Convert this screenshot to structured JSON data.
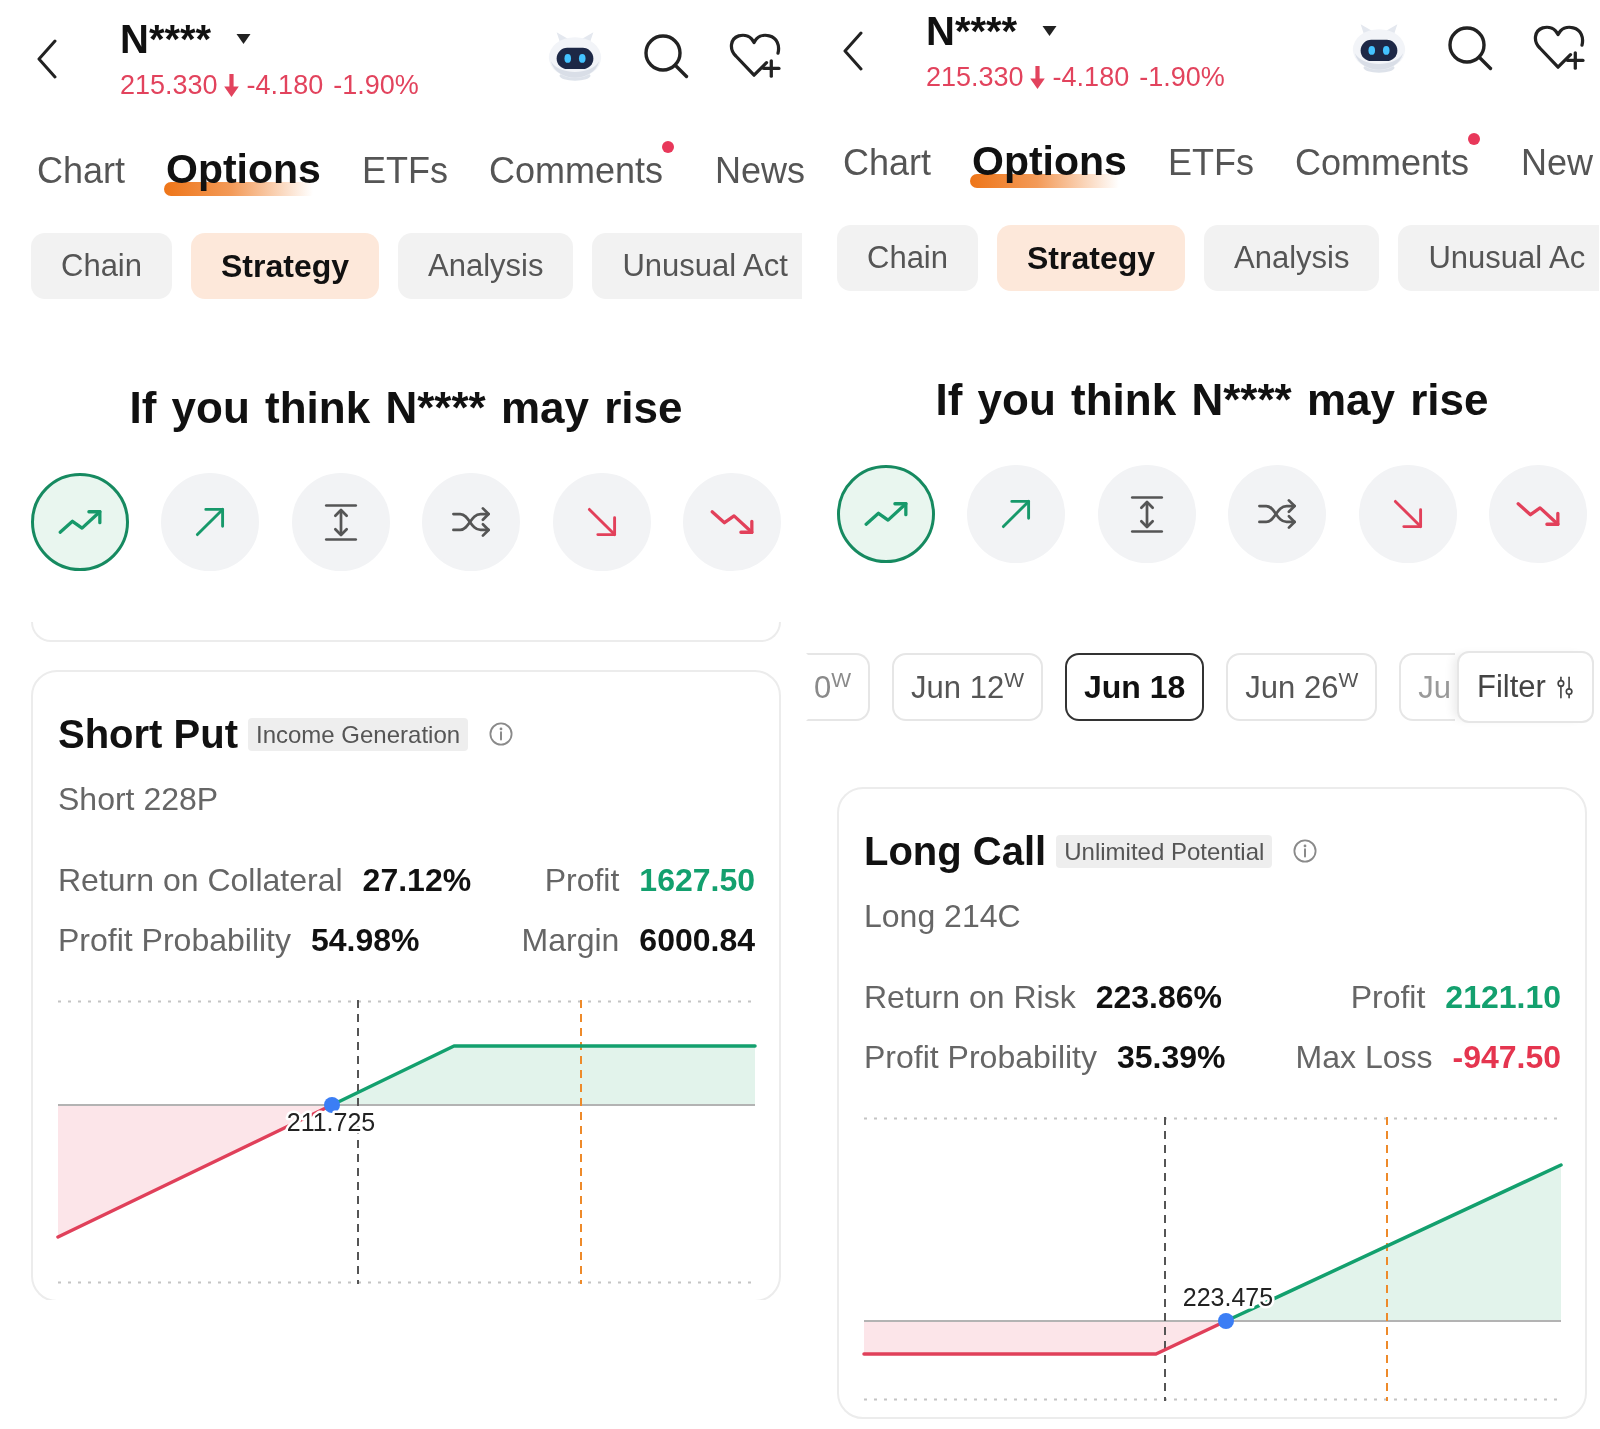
{
  "screens": [
    {
      "header": {
        "symbol": "N****",
        "price": "215.330",
        "change": "-4.180",
        "change_percent": "-1.90%"
      },
      "tabs": [
        {
          "label": "Chart",
          "selected": false,
          "dot": false
        },
        {
          "label": "Options",
          "selected": true,
          "dot": false
        },
        {
          "label": "ETFs",
          "selected": false,
          "dot": false
        },
        {
          "label": "Comments",
          "selected": false,
          "dot": true
        },
        {
          "label": "News",
          "selected": false,
          "dot": false
        }
      ],
      "subtabs": [
        {
          "label": "Chain",
          "selected": false
        },
        {
          "label": "Strategy",
          "selected": true
        },
        {
          "label": "Analysis",
          "selected": false
        },
        {
          "label": "Unusual Act",
          "selected": false
        }
      ],
      "heading": "If you think N**** may rise",
      "outlooks": [
        {
          "kind": "trend_up",
          "selected": true
        },
        {
          "kind": "arrow_up",
          "selected": false
        },
        {
          "kind": "range",
          "selected": false
        },
        {
          "kind": "shuffle",
          "selected": false
        },
        {
          "kind": "arrow_down",
          "selected": false
        },
        {
          "kind": "trend_down",
          "selected": false
        }
      ],
      "partial_card_above": true,
      "strategy": {
        "kind": "short_put",
        "name": "Short Put",
        "tag": "Income Generation",
        "legs": "Short 228P",
        "metrics": [
          {
            "label": "Return on Collateral",
            "value": "27.12%",
            "color": "#111111"
          },
          {
            "label": "Profit",
            "value": "1627.50",
            "color": "#13a06e"
          },
          {
            "label": "Profit Probability",
            "value": "54.98%",
            "color": "#111111"
          },
          {
            "label": "Margin",
            "value": "6000.84",
            "color": "#111111"
          }
        ],
        "breakeven": "211.725"
      }
    },
    {
      "header": {
        "symbol": "N****",
        "price": "215.330",
        "change": "-4.180",
        "change_percent": "-1.90%"
      },
      "tabs": [
        {
          "label": "Chart",
          "selected": false,
          "dot": false
        },
        {
          "label": "Options",
          "selected": true,
          "dot": false
        },
        {
          "label": "ETFs",
          "selected": false,
          "dot": false
        },
        {
          "label": "Comments",
          "selected": false,
          "dot": true
        },
        {
          "label": "New",
          "selected": false,
          "dot": false
        }
      ],
      "subtabs": [
        {
          "label": "Chain",
          "selected": false
        },
        {
          "label": "Strategy",
          "selected": true
        },
        {
          "label": "Analysis",
          "selected": false
        },
        {
          "label": "Unusual Ac",
          "selected": false
        }
      ],
      "heading": "If you think N**** may rise",
      "outlooks": [
        {
          "kind": "trend_up",
          "selected": true
        },
        {
          "kind": "arrow_up",
          "selected": false
        },
        {
          "kind": "range",
          "selected": false
        },
        {
          "kind": "shuffle",
          "selected": false
        },
        {
          "kind": "arrow_down",
          "selected": false
        },
        {
          "kind": "trend_down",
          "selected": false
        }
      ],
      "expiry_dates": [
        {
          "label": "0$^{W}$",
          "selected": false
        },
        {
          "label": "Jun 12$^{W}$",
          "selected": false
        },
        {
          "label": "Jun 18",
          "selected": true
        },
        {
          "label": "Jun 26$^{W}$",
          "selected": false
        },
        {
          "label": "Ju",
          "selected": false
        }
      ],
      "filter": {
        "label": "Filter"
      },
      "strategy": {
        "kind": "long_call",
        "name": "Long Call",
        "tag": "Unlimited Potential",
        "legs": "Long 214C",
        "metrics": [
          {
            "label": "Return on Risk",
            "value": "223.86%",
            "color": "#111111"
          },
          {
            "label": "Profit",
            "value": "2121.10",
            "color": "#13a06e"
          },
          {
            "label": "Profit Probability",
            "value": "35.39%",
            "color": "#111111"
          },
          {
            "label": "Max Loss",
            "value": "-947.50",
            "color": "#e5354f"
          }
        ],
        "breakeven": "223.475"
      }
    }
  ]
}
